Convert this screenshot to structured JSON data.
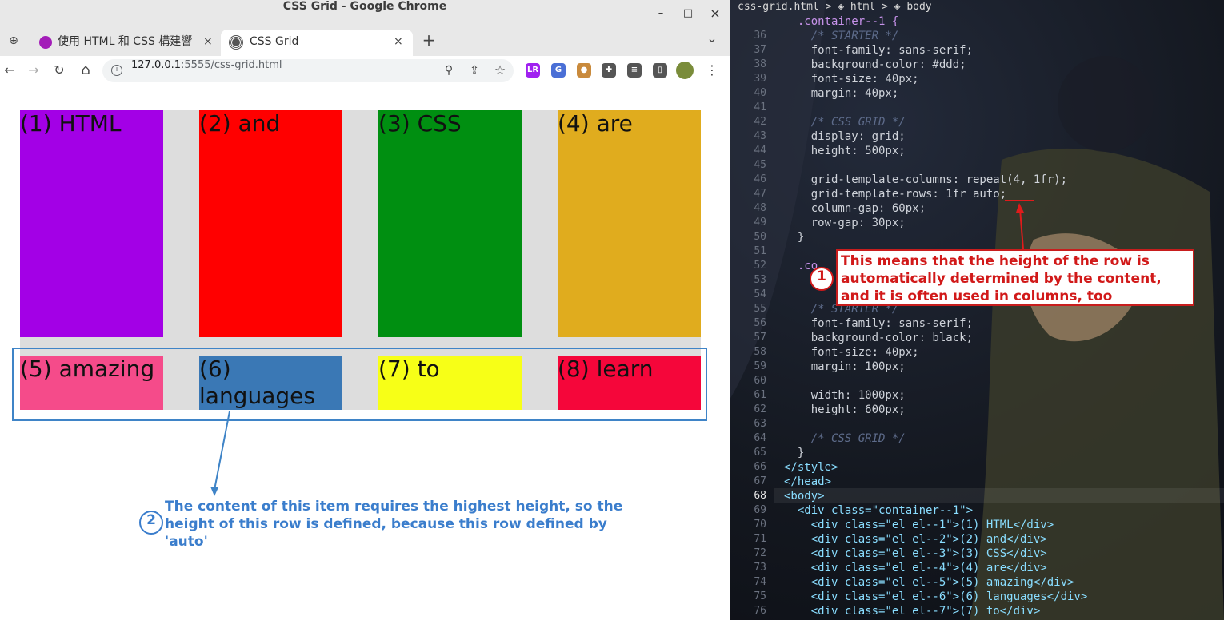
{
  "window": {
    "title": "CSS Grid - Google Chrome",
    "minimize": "–",
    "maximize": "□",
    "close": "×"
  },
  "tabs": [
    {
      "title": "使用 HTML 和 CSS 構建響應",
      "close": "×",
      "active": false
    },
    {
      "title": "CSS Grid",
      "close": "×",
      "active": true
    }
  ],
  "tabstrip": {
    "new_tab": "+",
    "tab_search": "⌄"
  },
  "toolbar": {
    "back": "←",
    "forward": "→",
    "reload": "↻",
    "home": "⌂",
    "url_host": "127.0.0.1",
    "url_path": ":5555/css-grid.html",
    "zoom": "⚲",
    "share": "⇪",
    "bookmark": "☆",
    "menu": "⋮",
    "extensions": [
      {
        "name": "lr-extension-icon",
        "text": "LR",
        "color": "#a020f0"
      },
      {
        "name": "translate-extension-icon",
        "text": "G",
        "color": "#4a6fd6"
      },
      {
        "name": "cookie-extension-icon",
        "text": "●",
        "color": "#c98a3c"
      },
      {
        "name": "puzzle-extension-icon",
        "text": "✚",
        "color": "#555555"
      },
      {
        "name": "playlist-extension-icon",
        "text": "≡",
        "color": "#555555"
      },
      {
        "name": "sidepanel-icon",
        "text": "▯",
        "color": "#555555"
      }
    ]
  },
  "grid_items": [
    {
      "text": "(1) HTML",
      "color": "#a300e6"
    },
    {
      "text": "(2) and",
      "color": "#ff0000"
    },
    {
      "text": "(3) CSS",
      "color": "#008f11"
    },
    {
      "text": "(4) are",
      "color": "#e0ac1e"
    },
    {
      "text": "(5) amazing",
      "color": "#f54b8a"
    },
    {
      "text": "(6) languages",
      "color": "#3a78b5"
    },
    {
      "text": "(7) to",
      "color": "#f7ff17"
    },
    {
      "text": "(8) learn",
      "color": "#f5063a"
    }
  ],
  "annotation2": {
    "badge": "2",
    "text": "The content of this item requires the highest height, so the height of this row is defined, because this row defined by 'auto'"
  },
  "annotation1": {
    "badge": "1",
    "text": "This means that the height of the row is automatically determined by the content, and it is often used in columns, too"
  },
  "editor": {
    "breadcrumb": "css-grid.html > ◈ html > ◈ body",
    "current_line": "68",
    "lines": [
      {
        "n": "",
        "code": "  .container--1 {",
        "cls": "sel"
      },
      {
        "n": "36",
        "code": "    /* STARTER */",
        "cls": "cmt"
      },
      {
        "n": "37",
        "code": "    font-family: sans-serif;",
        "cls": "pl"
      },
      {
        "n": "38",
        "code": "    background-color: #ddd;",
        "cls": "pl"
      },
      {
        "n": "39",
        "code": "    font-size: 40px;",
        "cls": "pl"
      },
      {
        "n": "40",
        "code": "    margin: 40px;",
        "cls": "pl"
      },
      {
        "n": "41",
        "code": "",
        "cls": "pl"
      },
      {
        "n": "42",
        "code": "    /* CSS GRID */",
        "cls": "cmt"
      },
      {
        "n": "43",
        "code": "    display: grid;",
        "cls": "pl"
      },
      {
        "n": "44",
        "code": "    height: 500px;",
        "cls": "pl"
      },
      {
        "n": "45",
        "code": "",
        "cls": "pl"
      },
      {
        "n": "46",
        "code": "    grid-template-columns: repeat(4, 1fr);",
        "cls": "pl"
      },
      {
        "n": "47",
        "code": "    grid-template-rows: 1fr auto;",
        "cls": "pl"
      },
      {
        "n": "48",
        "code": "    column-gap: 60px;",
        "cls": "pl"
      },
      {
        "n": "49",
        "code": "    row-gap: 30px;",
        "cls": "pl"
      },
      {
        "n": "50",
        "code": "  }",
        "cls": "pl"
      },
      {
        "n": "51",
        "code": "",
        "cls": "pl"
      },
      {
        "n": "52",
        "code": "  .co",
        "cls": "sel"
      },
      {
        "n": "53",
        "code": "",
        "cls": "pl"
      },
      {
        "n": "54",
        "code": "",
        "cls": "pl"
      },
      {
        "n": "55",
        "code": "    /* STARTER */",
        "cls": "cmt"
      },
      {
        "n": "56",
        "code": "    font-family: sans-serif;",
        "cls": "pl"
      },
      {
        "n": "57",
        "code": "    background-color: black;",
        "cls": "pl"
      },
      {
        "n": "58",
        "code": "    font-size: 40px;",
        "cls": "pl"
      },
      {
        "n": "59",
        "code": "    margin: 100px;",
        "cls": "pl"
      },
      {
        "n": "60",
        "code": "",
        "cls": "pl"
      },
      {
        "n": "61",
        "code": "    width: 1000px;",
        "cls": "pl"
      },
      {
        "n": "62",
        "code": "    height: 600px;",
        "cls": "pl"
      },
      {
        "n": "63",
        "code": "",
        "cls": "pl"
      },
      {
        "n": "64",
        "code": "    /* CSS GRID */",
        "cls": "cmt"
      },
      {
        "n": "65",
        "code": "  }",
        "cls": "pl"
      },
      {
        "n": "66",
        "code": "</style>",
        "cls": "tag"
      },
      {
        "n": "67",
        "code": "</head>",
        "cls": "tag"
      },
      {
        "n": "68",
        "code": "<body>",
        "cls": "tag"
      },
      {
        "n": "69",
        "code": "  <div class=\"container--1\">",
        "cls": "tag"
      },
      {
        "n": "70",
        "code": "    <div class=\"el el--1\">(1) HTML</div>",
        "cls": "tag"
      },
      {
        "n": "71",
        "code": "    <div class=\"el el--2\">(2) and</div>",
        "cls": "tag"
      },
      {
        "n": "72",
        "code": "    <div class=\"el el--3\">(3) CSS</div>",
        "cls": "tag"
      },
      {
        "n": "73",
        "code": "    <div class=\"el el--4\">(4) are</div>",
        "cls": "tag"
      },
      {
        "n": "74",
        "code": "    <div class=\"el el--5\">(5) amazing</div>",
        "cls": "tag"
      },
      {
        "n": "75",
        "code": "    <div class=\"el el--6\">(6) languages</div>",
        "cls": "tag"
      },
      {
        "n": "76",
        "code": "    <div class=\"el el--7\">(7) to</div>",
        "cls": "tag"
      }
    ]
  }
}
